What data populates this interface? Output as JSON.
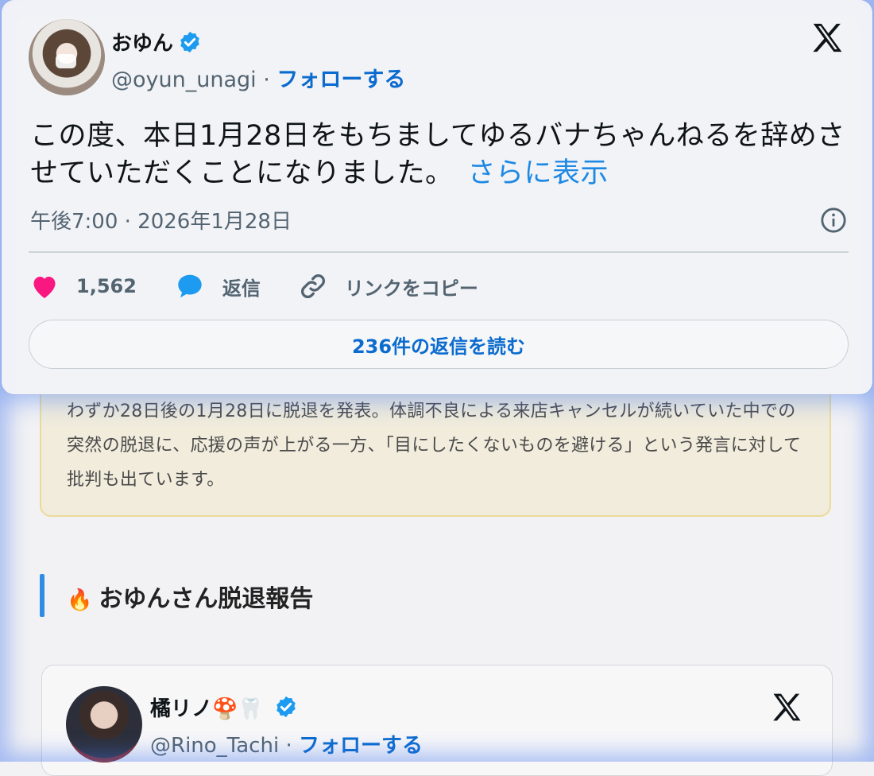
{
  "tweet": {
    "name": "おゆん",
    "handle": "@oyun_unagi",
    "separator": " · ",
    "follow_label": "フォローする",
    "body": "この度、本日1月28日をもちましてゆるバナちゃんねるを辞めさせていただくことになりました。",
    "show_more": "さらに表示",
    "timestamp": "午後7:00 · 2026年1月28日",
    "likes": "1,562",
    "reply_label": "返信",
    "copy_link_label": "リンクをコピー",
    "read_replies_label": "236件の返信を読む"
  },
  "article": {
    "summary": "わずか28日後の1月28日に脱退を発表。体調不良による来店キャンセルが続いていた中での突然の脱退に、応援の声が上がる一方、「目にしたくないものを避ける」という発言に対して批判も出ています。",
    "section_emoji": "🔥",
    "section_title": "おゆんさん脱退報告"
  },
  "tweet2": {
    "name": "橘リノ🍄🦷",
    "handle": "@Rino_Tachi",
    "separator": " · ",
    "follow_label": "フォローする"
  },
  "colors": {
    "link_blue": "#0b6bce",
    "verified_blue": "#1d9bf0",
    "heart_pink": "#f91880",
    "summary_bg": "#f1ecdc",
    "summary_border": "#eadb9a",
    "section_bar": "#2f8de4"
  }
}
